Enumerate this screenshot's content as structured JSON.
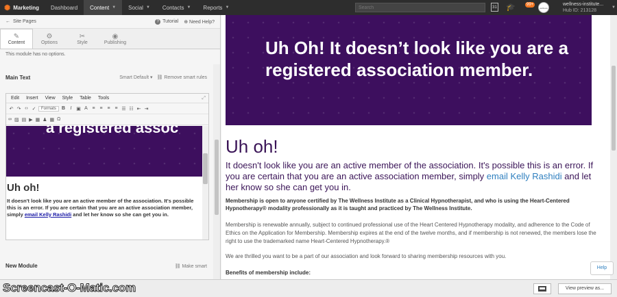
{
  "nav": {
    "brand": "Marketing",
    "items": [
      {
        "label": "Dashboard",
        "active": false,
        "caret": false
      },
      {
        "label": "Content",
        "active": true,
        "caret": true
      },
      {
        "label": "Social",
        "active": false,
        "caret": true
      },
      {
        "label": "Contacts",
        "active": false,
        "caret": true
      },
      {
        "label": "Reports",
        "active": false,
        "caret": true
      }
    ],
    "search_placeholder": "Search",
    "calendar_day": "31",
    "notif_count": "99+",
    "avatar_text": "wellness",
    "account_name": "wellness-institute...",
    "hub_id": "Hub ID: 213128"
  },
  "left": {
    "back_label": "Site Pages",
    "tutorial": "Tutorial",
    "need_help": "Need Help?",
    "tabs": [
      {
        "label": "Content",
        "icon": "pencil-icon",
        "glyph": "✎",
        "active": true
      },
      {
        "label": "Options",
        "icon": "gear-icon",
        "glyph": "⚙",
        "active": false
      },
      {
        "label": "Style",
        "icon": "scissors-icon",
        "glyph": "✂",
        "active": false
      },
      {
        "label": "Publishing",
        "icon": "globe-icon",
        "glyph": "◉",
        "active": false
      }
    ],
    "no_options": "This module has no options.",
    "main_text_title": "Main Text",
    "smart_default": "Smart Default",
    "remove_smart": "Remove smart rules",
    "editor_menu": [
      "Edit",
      "Insert",
      "View",
      "Style",
      "Table",
      "Tools"
    ],
    "formats": "Formats",
    "mini_banner": "a registered assoc",
    "mini_heading": "Uh oh!",
    "mini_para_before": "It doesn't look like you are an active member of the association. It's possible this is an error. If you are certain that you are an active association member, simply ",
    "mini_link": "email Kelly Rashidi",
    "mini_para_after": " and let her know so she can get you in.",
    "new_module": "New Module",
    "make_smart": "Make smart"
  },
  "preview": {
    "banner_title": "Uh Oh! It doesn’t look like you are a registered association member.",
    "heading": "Uh oh!",
    "lead_before": "It doesn't look like you are an active member of the association. It's possible this is an error. If you are certain that you are an active association member, simply ",
    "lead_link": "email Kelly Rashidi",
    "lead_after": " and let her know so she can get you in.",
    "bold_para": "Membership is open to anyone certified by The Wellness Institute as a Clinical Hypnotherapist, and who is using the Heart-Centered Hypnotherapy® modality professionally as it is taught and practiced by The Wellness Institute.",
    "para1": "Membership is renewable annually, subject to continued professional use of the Heart Centered Hypnotherapy modality, and adherence to the Code of Ethics on the Application for Membership. Membership expires at the end of the twelve months, and if membership is not renewed, the members lose the right to use the trademarked name Heart-Centered Hypnotherapy.®",
    "para2": "We are thrilled you want to be a part of our association and look forward to sharing membership resources with you.",
    "benefits": "Benefits of membership include:",
    "help": "Help"
  },
  "bottom": {
    "watermark": "Screencast-O-Matic.com",
    "view_preview": "View preview as..."
  },
  "colors": {
    "banner_purple": "#3d0f5e",
    "heading_purple": "#3a1457",
    "link_blue": "#2e7fbf",
    "brand_orange": "#f57722"
  }
}
